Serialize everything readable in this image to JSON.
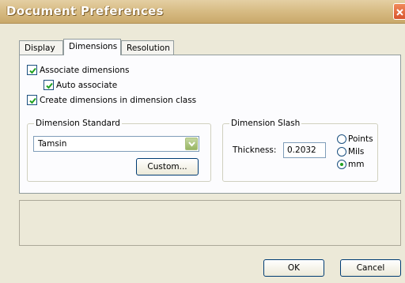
{
  "window": {
    "title": "Document Preferences"
  },
  "tabs": [
    {
      "label": "Display",
      "active": false
    },
    {
      "label": "Dimensions",
      "active": true
    },
    {
      "label": "Resolution",
      "active": false
    }
  ],
  "options": {
    "associate": {
      "label": "Associate dimensions",
      "checked": true
    },
    "auto_associate": {
      "label": "Auto associate",
      "checked": true
    },
    "create_in_class": {
      "label": "Create dimensions in dimension class",
      "checked": true
    }
  },
  "standard": {
    "group_label": "Dimension Standard",
    "selected": "Tamsin",
    "custom_button": "Custom..."
  },
  "slash": {
    "group_label": "Dimension Slash",
    "thickness_label": "Thickness:",
    "thickness_value": "0.2032",
    "units": [
      {
        "label": "Points",
        "selected": false
      },
      {
        "label": "Mils",
        "selected": false
      },
      {
        "label": "mm",
        "selected": true
      }
    ]
  },
  "footer": {
    "ok_label": "OK",
    "cancel_label": "Cancel"
  },
  "colors": {
    "titlebar": "#d8bd86",
    "check": "#21a121",
    "close": "#d8532c"
  }
}
